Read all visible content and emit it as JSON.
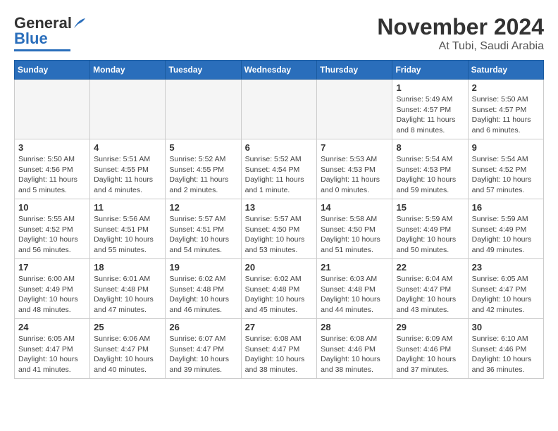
{
  "header": {
    "logo_general": "General",
    "logo_blue": "Blue",
    "month_title": "November 2024",
    "location": "At Tubi, Saudi Arabia"
  },
  "weekdays": [
    "Sunday",
    "Monday",
    "Tuesday",
    "Wednesday",
    "Thursday",
    "Friday",
    "Saturday"
  ],
  "weeks": [
    [
      {
        "day": "",
        "info": ""
      },
      {
        "day": "",
        "info": ""
      },
      {
        "day": "",
        "info": ""
      },
      {
        "day": "",
        "info": ""
      },
      {
        "day": "",
        "info": ""
      },
      {
        "day": "1",
        "info": "Sunrise: 5:49 AM\nSunset: 4:57 PM\nDaylight: 11 hours and 8 minutes."
      },
      {
        "day": "2",
        "info": "Sunrise: 5:50 AM\nSunset: 4:57 PM\nDaylight: 11 hours and 6 minutes."
      }
    ],
    [
      {
        "day": "3",
        "info": "Sunrise: 5:50 AM\nSunset: 4:56 PM\nDaylight: 11 hours and 5 minutes."
      },
      {
        "day": "4",
        "info": "Sunrise: 5:51 AM\nSunset: 4:55 PM\nDaylight: 11 hours and 4 minutes."
      },
      {
        "day": "5",
        "info": "Sunrise: 5:52 AM\nSunset: 4:55 PM\nDaylight: 11 hours and 2 minutes."
      },
      {
        "day": "6",
        "info": "Sunrise: 5:52 AM\nSunset: 4:54 PM\nDaylight: 11 hours and 1 minute."
      },
      {
        "day": "7",
        "info": "Sunrise: 5:53 AM\nSunset: 4:53 PM\nDaylight: 11 hours and 0 minutes."
      },
      {
        "day": "8",
        "info": "Sunrise: 5:54 AM\nSunset: 4:53 PM\nDaylight: 10 hours and 59 minutes."
      },
      {
        "day": "9",
        "info": "Sunrise: 5:54 AM\nSunset: 4:52 PM\nDaylight: 10 hours and 57 minutes."
      }
    ],
    [
      {
        "day": "10",
        "info": "Sunrise: 5:55 AM\nSunset: 4:52 PM\nDaylight: 10 hours and 56 minutes."
      },
      {
        "day": "11",
        "info": "Sunrise: 5:56 AM\nSunset: 4:51 PM\nDaylight: 10 hours and 55 minutes."
      },
      {
        "day": "12",
        "info": "Sunrise: 5:57 AM\nSunset: 4:51 PM\nDaylight: 10 hours and 54 minutes."
      },
      {
        "day": "13",
        "info": "Sunrise: 5:57 AM\nSunset: 4:50 PM\nDaylight: 10 hours and 53 minutes."
      },
      {
        "day": "14",
        "info": "Sunrise: 5:58 AM\nSunset: 4:50 PM\nDaylight: 10 hours and 51 minutes."
      },
      {
        "day": "15",
        "info": "Sunrise: 5:59 AM\nSunset: 4:49 PM\nDaylight: 10 hours and 50 minutes."
      },
      {
        "day": "16",
        "info": "Sunrise: 5:59 AM\nSunset: 4:49 PM\nDaylight: 10 hours and 49 minutes."
      }
    ],
    [
      {
        "day": "17",
        "info": "Sunrise: 6:00 AM\nSunset: 4:49 PM\nDaylight: 10 hours and 48 minutes."
      },
      {
        "day": "18",
        "info": "Sunrise: 6:01 AM\nSunset: 4:48 PM\nDaylight: 10 hours and 47 minutes."
      },
      {
        "day": "19",
        "info": "Sunrise: 6:02 AM\nSunset: 4:48 PM\nDaylight: 10 hours and 46 minutes."
      },
      {
        "day": "20",
        "info": "Sunrise: 6:02 AM\nSunset: 4:48 PM\nDaylight: 10 hours and 45 minutes."
      },
      {
        "day": "21",
        "info": "Sunrise: 6:03 AM\nSunset: 4:48 PM\nDaylight: 10 hours and 44 minutes."
      },
      {
        "day": "22",
        "info": "Sunrise: 6:04 AM\nSunset: 4:47 PM\nDaylight: 10 hours and 43 minutes."
      },
      {
        "day": "23",
        "info": "Sunrise: 6:05 AM\nSunset: 4:47 PM\nDaylight: 10 hours and 42 minutes."
      }
    ],
    [
      {
        "day": "24",
        "info": "Sunrise: 6:05 AM\nSunset: 4:47 PM\nDaylight: 10 hours and 41 minutes."
      },
      {
        "day": "25",
        "info": "Sunrise: 6:06 AM\nSunset: 4:47 PM\nDaylight: 10 hours and 40 minutes."
      },
      {
        "day": "26",
        "info": "Sunrise: 6:07 AM\nSunset: 4:47 PM\nDaylight: 10 hours and 39 minutes."
      },
      {
        "day": "27",
        "info": "Sunrise: 6:08 AM\nSunset: 4:47 PM\nDaylight: 10 hours and 38 minutes."
      },
      {
        "day": "28",
        "info": "Sunrise: 6:08 AM\nSunset: 4:46 PM\nDaylight: 10 hours and 38 minutes."
      },
      {
        "day": "29",
        "info": "Sunrise: 6:09 AM\nSunset: 4:46 PM\nDaylight: 10 hours and 37 minutes."
      },
      {
        "day": "30",
        "info": "Sunrise: 6:10 AM\nSunset: 4:46 PM\nDaylight: 10 hours and 36 minutes."
      }
    ]
  ]
}
